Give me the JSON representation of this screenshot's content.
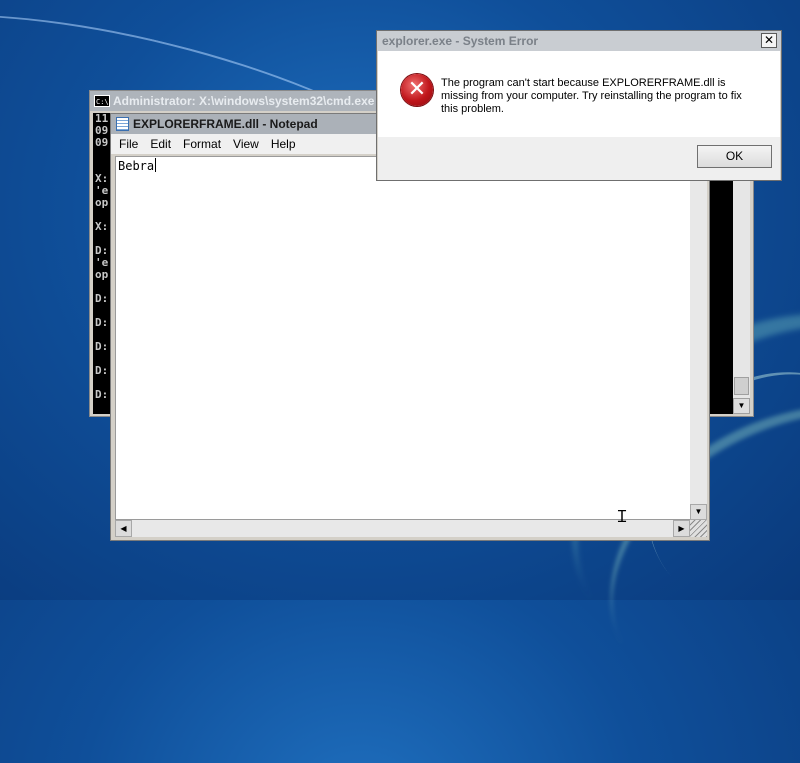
{
  "cmd": {
    "title": "Administrator: X:\\windows\\system32\\cmd.exe",
    "icon_label": "C:\\",
    "lines": [
      "11",
      "09",
      "09",
      "",
      "",
      "X:",
      "'e",
      "op",
      "",
      "X:",
      "",
      "D:",
      "'e",
      "op",
      "",
      "D:",
      "",
      "D:",
      "",
      "D:",
      "",
      "D:",
      "",
      "D:"
    ]
  },
  "notepad": {
    "title": "EXPLORERFRAME.dll - Notepad",
    "menu": [
      "File",
      "Edit",
      "Format",
      "View",
      "Help"
    ],
    "content": "Bebra"
  },
  "dialog": {
    "title": "explorer.exe - System Error",
    "message": "The program can't start because EXPLORERFRAME.dll is missing from your computer. Try reinstalling the program to fix this problem.",
    "ok_label": "OK",
    "close_glyph": "✕",
    "icon": "error-icon",
    "icon_glyph": "✕"
  },
  "colors": {
    "error_red": "#c0161b",
    "desktop_blue": "#1f6fbe"
  }
}
